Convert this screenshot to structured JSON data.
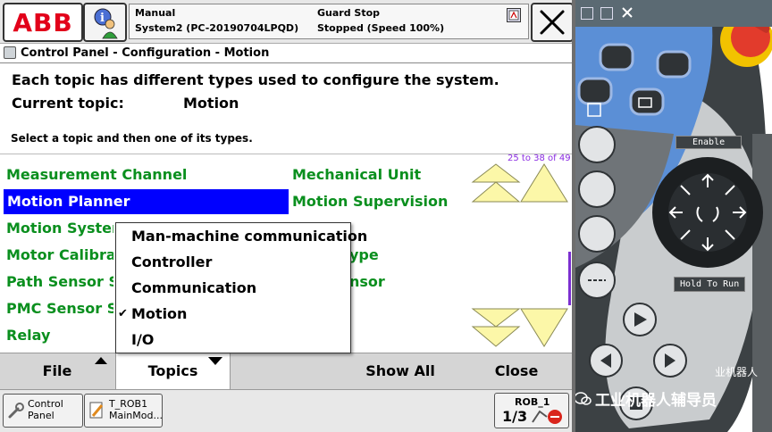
{
  "header": {
    "logo_text": "ABB",
    "mode": "Manual",
    "system": "System2 (PC-20190704LPQD)",
    "guard": "Guard Stop",
    "state": "Stopped (Speed 100%)"
  },
  "breadcrumb": "Control Panel - Configuration - Motion",
  "intro": "Each topic has different types used to configure the system.",
  "current_topic": {
    "label": "Current topic:",
    "value": "Motion"
  },
  "instruction": "Select a topic and then one of its types.",
  "range": "25 to 38 of 49",
  "types_col1": [
    "Measurement Channel",
    "Motion Planner",
    "Motion System",
    "Motor Calibration",
    "Path Sensor Sy",
    "PMC Sensor Se",
    "Relay"
  ],
  "types_col2": [
    "Mechanical Unit",
    "Motion Supervision",
    "",
    "ype",
    "nsor",
    "",
    ""
  ],
  "selected_type": "Motion Planner",
  "topics_menu": {
    "items": [
      "Man-machine communication",
      "Controller",
      "Communication",
      "Motion",
      "I/O"
    ],
    "checked": "Motion",
    "check_mark": "✔"
  },
  "bottom": {
    "file": "File",
    "topics": "Topics",
    "show_all": "Show All",
    "close": "Close"
  },
  "taskbar": {
    "control_panel": "Control\nPanel",
    "task": "T_ROB1\nMainMod...",
    "robot": "ROB_1",
    "robot_fraction": "1/3"
  },
  "hardware": {
    "enable_label": "Enable",
    "hold_to_run_label": "Hold To Run",
    "watermark": "工业机器人辅导员",
    "side_text": "业机器人"
  },
  "colors": {
    "accent_green": "#0a8f1e",
    "selection_blue": "#0000ff",
    "abb_red": "#e2001a",
    "arrow_yellow": "#fcf7a8",
    "pendant_gray": "#4a4f52",
    "key_blue": "#5b8fd6",
    "estop_red": "#e23b2c"
  }
}
